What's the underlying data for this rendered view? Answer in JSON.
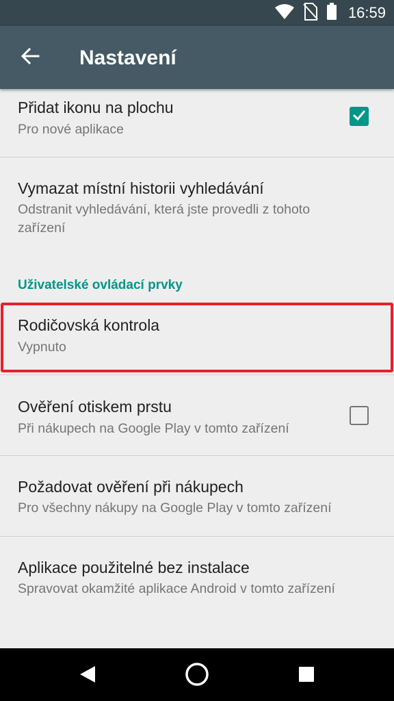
{
  "status_bar": {
    "time": "16:59",
    "icons": [
      "wifi-icon",
      "no-sim-icon",
      "battery-icon"
    ]
  },
  "app_bar": {
    "title": "Nastavení",
    "back_icon": "arrow-back-icon"
  },
  "settings": {
    "add_icon": {
      "title": "Přidat ikonu na plochu",
      "subtitle": "Pro nové aplikace",
      "checked": true
    },
    "clear_history": {
      "title": "Vymazat místní historii vyhledávání",
      "subtitle": "Odstranit vyhledávání, která jste provedli z tohoto zařízení"
    },
    "section_header": "Uživatelské ovládací prvky",
    "parental": {
      "title": "Rodičovská kontrola",
      "subtitle": "Vypnuto"
    },
    "fingerprint": {
      "title": "Ověření otiskem prstu",
      "subtitle": "Při nákupech na Google Play v tomto zařízení",
      "checked": false
    },
    "require_auth": {
      "title": "Požadovat ověření při nákupech",
      "subtitle": "Pro všechny nákupy na Google Play v tomto zařízení"
    },
    "instant_apps": {
      "title": "Aplikace použitelné bez instalace",
      "subtitle": "Spravovat okamžité aplikace Android v tomto zařízení"
    }
  },
  "nav_bar": {
    "buttons": [
      "back-triangle-icon",
      "home-circle-icon",
      "recents-square-icon"
    ]
  },
  "colors": {
    "accent": "#009688",
    "app_bar": "#455a64",
    "status_bar": "#37474f",
    "highlight": "#e8202a"
  }
}
